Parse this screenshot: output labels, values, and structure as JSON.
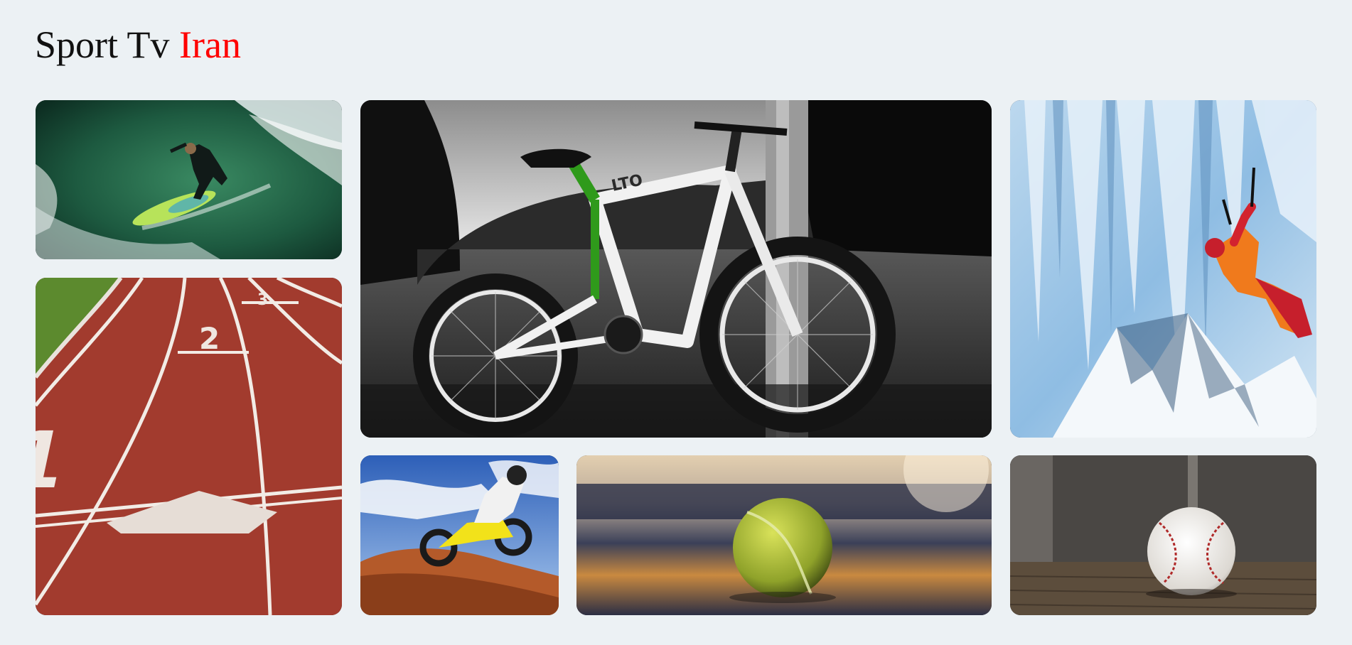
{
  "header": {
    "title_main": "Sport Tv",
    "title_accent": "Iran",
    "accent_color": "#ff0000"
  },
  "gallery": {
    "tiles": [
      {
        "subject": "surfer riding a wave"
      },
      {
        "subject": "red running track with lanes 1, 2, 3",
        "lane_numbers": [
          "1",
          "2",
          "3"
        ]
      },
      {
        "subject": "mountain bike leaning on a tree",
        "frame_text": "LTO"
      },
      {
        "subject": "ice climber on a frozen waterfall"
      },
      {
        "subject": "motocross rider jumping"
      },
      {
        "subject": "tennis ball on court at sunset"
      },
      {
        "subject": "baseball on wooden floor"
      }
    ]
  },
  "colors": {
    "background": "#ecf1f4",
    "title_text": "#111111",
    "track_red": "#a23b2e",
    "track_grass": "#5c8a2e",
    "bike_green": "#2f9a1b"
  }
}
